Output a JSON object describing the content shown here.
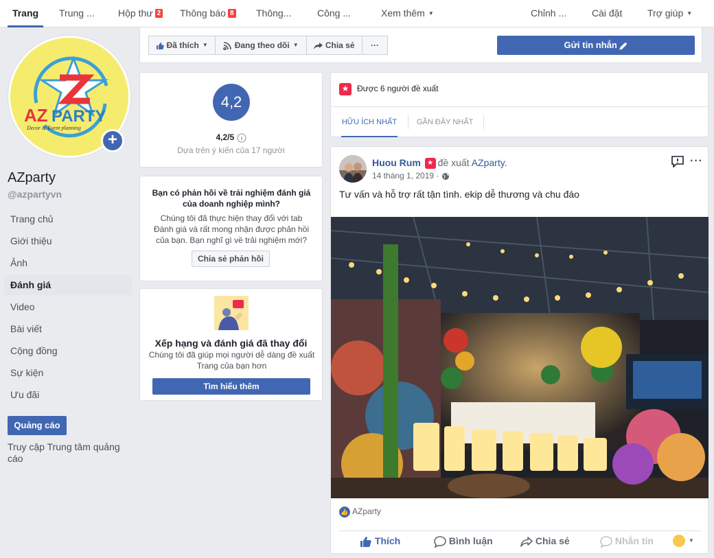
{
  "topnav": {
    "tabs": [
      {
        "label": "Trang"
      },
      {
        "label": "Trung ..."
      },
      {
        "label": "Hộp thư",
        "badge": "2"
      },
      {
        "label": "Thông báo",
        "badge": "8"
      },
      {
        "label": "Thông..."
      },
      {
        "label": "Công ..."
      },
      {
        "label": "Xem thêm"
      }
    ],
    "right": [
      {
        "label": "Chỉnh ..."
      },
      {
        "label": "Cài đặt"
      },
      {
        "label": "Trợ giúp"
      }
    ]
  },
  "profile": {
    "name": "AZparty",
    "handle": "@azpartyvn"
  },
  "sidebar": {
    "items": [
      {
        "label": "Trang chủ"
      },
      {
        "label": "Giới thiệu"
      },
      {
        "label": "Ảnh"
      },
      {
        "label": "Đánh giá"
      },
      {
        "label": "Video"
      },
      {
        "label": "Bài viết"
      },
      {
        "label": "Cộng đồng"
      },
      {
        "label": "Sự kiện"
      },
      {
        "label": "Ưu đãi"
      }
    ],
    "ads_button": "Quảng cáo",
    "ads_link": "Truy cập Trung tâm quảng cáo"
  },
  "actions": {
    "liked": "Đã thích",
    "following": "Đang theo dõi",
    "share": "Chia sẻ",
    "more": "···",
    "send_message": "Gửi tin nhắn"
  },
  "rating": {
    "score": "4,2",
    "score_line": "4,2/5",
    "based_on": "Dựa trên ý kiến của 17 người"
  },
  "feedback": {
    "title": "Bạn có phản hồi về trải nghiệm đánh giá của doanh nghiệp mình?",
    "body": "Chúng tôi đã thực hiện thay đổi với tab Đánh giá và rất mong nhận được phản hồi của bạn. Bạn nghĩ gì về trải nghiệm mới?",
    "button": "Chia sẻ phản hồi"
  },
  "changes": {
    "title": "Xếp hạng và đánh giá đã thay đổi",
    "body": "Chúng tôi đã giúp mọi người dễ dàng đề xuất Trang của bạn hơn",
    "button": "Tìm hiểu thêm"
  },
  "recommend": {
    "summary": "Được 6 người đề xuất",
    "tabs": [
      "HỮU ÍCH NHẤT",
      "GẦN ĐÂY NHẤT"
    ]
  },
  "post": {
    "author": "Huou Rum",
    "verb": "đề xuất",
    "page": "AZparty.",
    "date": "14 tháng 1, 2019 ·",
    "text": "Tư vấn và hỗ trợ rất tận tình. ekip dễ thương và chu đáo",
    "liker": "AZparty",
    "actions": [
      "Thích",
      "Bình luận",
      "Chia sẻ",
      "Nhắn tin"
    ]
  },
  "colors": {
    "accent": "#4267b2",
    "badge": "#fa3e3e",
    "background": "#e9ebee"
  }
}
